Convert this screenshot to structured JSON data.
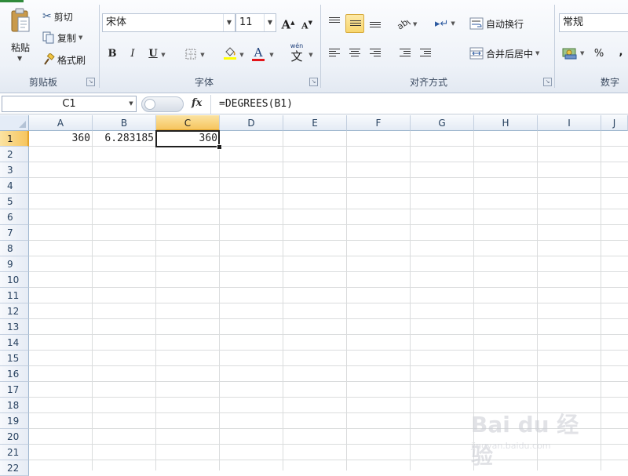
{
  "ribbon": {
    "clipboard": {
      "paste_label": "粘贴",
      "cut_label": "剪切",
      "copy_label": "复制",
      "format_painter_label": "格式刷",
      "group_label": "剪贴板"
    },
    "font": {
      "font_name": "宋体",
      "font_size": "11",
      "bold": "B",
      "italic": "I",
      "underline": "U",
      "font_color_letter": "A",
      "grow_font": "A",
      "shrink_font": "A",
      "phonetic_top": "wén",
      "phonetic_char": "文",
      "group_label": "字体"
    },
    "alignment": {
      "wrap_text_label": "自动换行",
      "merge_center_label": "合并后居中",
      "group_label": "对齐方式"
    },
    "number": {
      "format": "常规",
      "percent": "%",
      "comma": ",",
      "group_label": "数字"
    }
  },
  "formula_bar": {
    "name_box": "C1",
    "fx": "fx",
    "formula": "=DEGREES(B1)"
  },
  "grid": {
    "columns": [
      "A",
      "B",
      "C",
      "D",
      "E",
      "F",
      "G",
      "H",
      "I",
      "J"
    ],
    "selected_column": "C",
    "rows": [
      "1",
      "2",
      "3",
      "4",
      "5",
      "6",
      "7",
      "8",
      "9",
      "10",
      "11",
      "12",
      "13",
      "14",
      "15",
      "16",
      "17",
      "18",
      "19",
      "20",
      "21",
      "22"
    ],
    "selected_row": "1",
    "cells": {
      "A1": "360",
      "B1": "6.283185",
      "C1": "360"
    }
  },
  "watermark": {
    "text": "Bai du 经验",
    "sub": "jingyan.baidu.com"
  },
  "colors": {
    "accent_selected": "#f6c55e",
    "gridline": "#dadcdd",
    "header_text": "#27415f"
  }
}
